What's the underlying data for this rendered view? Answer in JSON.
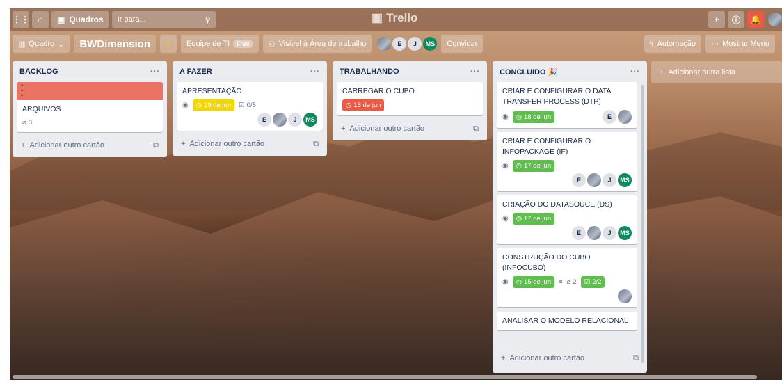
{
  "topbar": {
    "apps_icon": "grid-icon",
    "home_icon": "home-icon",
    "boards_label": "Quadros",
    "search_placeholder": "Ir para...",
    "logo_text": "Trello",
    "add_icon": "plus-icon",
    "info_icon": "info-icon",
    "bell_icon": "bell-icon"
  },
  "board": {
    "view_label": "Quadro",
    "title": "BWDimension",
    "team_label": "Equipe de TI",
    "team_badge": "Free",
    "visibility_label": "Visível à Área de trabalho",
    "invite_label": "Convidar",
    "automation_label": "Automação",
    "menu_label": "Mostrar Menu",
    "members": [
      "E",
      "J",
      "MS"
    ]
  },
  "lists": [
    {
      "title": "BACKLOG",
      "cards": [
        {
          "title": "ARQUIVOS",
          "attachments": "3"
        }
      ],
      "add_label": "Adicionar outro cartão"
    },
    {
      "title": "A FAZER",
      "cards": [
        {
          "title": "APRESENTAÇÃO",
          "date": "19 de jun",
          "checklist": "0/5",
          "members": [
            "E",
            "J",
            "MS"
          ]
        }
      ],
      "add_label": "Adicionar outro cartão"
    },
    {
      "title": "TRABALHANDO",
      "cards": [
        {
          "title": "CARREGAR O CUBO",
          "date": "18 de jun"
        }
      ],
      "add_label": "Adicionar outro cartão"
    },
    {
      "title": "CONCLUIDO",
      "emoji": "🎉",
      "cards": [
        {
          "title": "CRIAR E CONFIGURAR O DATA TRANSFER PROCESS (DTP)",
          "date": "18 de jun",
          "members": [
            "E"
          ]
        },
        {
          "title": "CRIAR E CONFIGURAR O INFOPACKAGE (IF)",
          "date": "17 de jun",
          "members": [
            "E",
            "J",
            "MS"
          ]
        },
        {
          "title": "CRIAÇÃO DO DATASOUCE (DS)",
          "date": "17 de jun",
          "members": [
            "E",
            "J",
            "MS"
          ]
        },
        {
          "title": "CONSTRUÇÃO DO CUBO (INFOCUBO)",
          "date": "15 de jun",
          "attachments": "2",
          "checklist": "2/2"
        },
        {
          "title": "ANALISAR O MODELO RELACIONAL"
        }
      ],
      "add_label": "Adicionar outro cartão"
    }
  ],
  "add_list_label": "Adicionar outra lista",
  "colors": {
    "date_yellow": "#f2d600",
    "date_red": "#eb5a46",
    "date_green": "#61bd4f",
    "cover_red": "#eb7363",
    "member_ms": "#0f8a5f"
  }
}
